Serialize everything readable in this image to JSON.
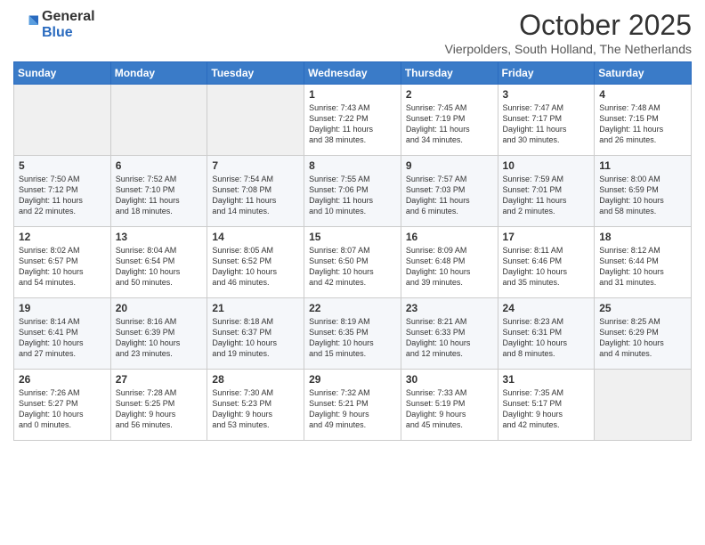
{
  "logo": {
    "general": "General",
    "blue": "Blue"
  },
  "header": {
    "month": "October 2025",
    "location": "Vierpolders, South Holland, The Netherlands"
  },
  "weekdays": [
    "Sunday",
    "Monday",
    "Tuesday",
    "Wednesday",
    "Thursday",
    "Friday",
    "Saturday"
  ],
  "weeks": [
    [
      {
        "day": "",
        "content": ""
      },
      {
        "day": "",
        "content": ""
      },
      {
        "day": "",
        "content": ""
      },
      {
        "day": "1",
        "content": "Sunrise: 7:43 AM\nSunset: 7:22 PM\nDaylight: 11 hours\nand 38 minutes."
      },
      {
        "day": "2",
        "content": "Sunrise: 7:45 AM\nSunset: 7:19 PM\nDaylight: 11 hours\nand 34 minutes."
      },
      {
        "day": "3",
        "content": "Sunrise: 7:47 AM\nSunset: 7:17 PM\nDaylight: 11 hours\nand 30 minutes."
      },
      {
        "day": "4",
        "content": "Sunrise: 7:48 AM\nSunset: 7:15 PM\nDaylight: 11 hours\nand 26 minutes."
      }
    ],
    [
      {
        "day": "5",
        "content": "Sunrise: 7:50 AM\nSunset: 7:12 PM\nDaylight: 11 hours\nand 22 minutes."
      },
      {
        "day": "6",
        "content": "Sunrise: 7:52 AM\nSunset: 7:10 PM\nDaylight: 11 hours\nand 18 minutes."
      },
      {
        "day": "7",
        "content": "Sunrise: 7:54 AM\nSunset: 7:08 PM\nDaylight: 11 hours\nand 14 minutes."
      },
      {
        "day": "8",
        "content": "Sunrise: 7:55 AM\nSunset: 7:06 PM\nDaylight: 11 hours\nand 10 minutes."
      },
      {
        "day": "9",
        "content": "Sunrise: 7:57 AM\nSunset: 7:03 PM\nDaylight: 11 hours\nand 6 minutes."
      },
      {
        "day": "10",
        "content": "Sunrise: 7:59 AM\nSunset: 7:01 PM\nDaylight: 11 hours\nand 2 minutes."
      },
      {
        "day": "11",
        "content": "Sunrise: 8:00 AM\nSunset: 6:59 PM\nDaylight: 10 hours\nand 58 minutes."
      }
    ],
    [
      {
        "day": "12",
        "content": "Sunrise: 8:02 AM\nSunset: 6:57 PM\nDaylight: 10 hours\nand 54 minutes."
      },
      {
        "day": "13",
        "content": "Sunrise: 8:04 AM\nSunset: 6:54 PM\nDaylight: 10 hours\nand 50 minutes."
      },
      {
        "day": "14",
        "content": "Sunrise: 8:05 AM\nSunset: 6:52 PM\nDaylight: 10 hours\nand 46 minutes."
      },
      {
        "day": "15",
        "content": "Sunrise: 8:07 AM\nSunset: 6:50 PM\nDaylight: 10 hours\nand 42 minutes."
      },
      {
        "day": "16",
        "content": "Sunrise: 8:09 AM\nSunset: 6:48 PM\nDaylight: 10 hours\nand 39 minutes."
      },
      {
        "day": "17",
        "content": "Sunrise: 8:11 AM\nSunset: 6:46 PM\nDaylight: 10 hours\nand 35 minutes."
      },
      {
        "day": "18",
        "content": "Sunrise: 8:12 AM\nSunset: 6:44 PM\nDaylight: 10 hours\nand 31 minutes."
      }
    ],
    [
      {
        "day": "19",
        "content": "Sunrise: 8:14 AM\nSunset: 6:41 PM\nDaylight: 10 hours\nand 27 minutes."
      },
      {
        "day": "20",
        "content": "Sunrise: 8:16 AM\nSunset: 6:39 PM\nDaylight: 10 hours\nand 23 minutes."
      },
      {
        "day": "21",
        "content": "Sunrise: 8:18 AM\nSunset: 6:37 PM\nDaylight: 10 hours\nand 19 minutes."
      },
      {
        "day": "22",
        "content": "Sunrise: 8:19 AM\nSunset: 6:35 PM\nDaylight: 10 hours\nand 15 minutes."
      },
      {
        "day": "23",
        "content": "Sunrise: 8:21 AM\nSunset: 6:33 PM\nDaylight: 10 hours\nand 12 minutes."
      },
      {
        "day": "24",
        "content": "Sunrise: 8:23 AM\nSunset: 6:31 PM\nDaylight: 10 hours\nand 8 minutes."
      },
      {
        "day": "25",
        "content": "Sunrise: 8:25 AM\nSunset: 6:29 PM\nDaylight: 10 hours\nand 4 minutes."
      }
    ],
    [
      {
        "day": "26",
        "content": "Sunrise: 7:26 AM\nSunset: 5:27 PM\nDaylight: 10 hours\nand 0 minutes."
      },
      {
        "day": "27",
        "content": "Sunrise: 7:28 AM\nSunset: 5:25 PM\nDaylight: 9 hours\nand 56 minutes."
      },
      {
        "day": "28",
        "content": "Sunrise: 7:30 AM\nSunset: 5:23 PM\nDaylight: 9 hours\nand 53 minutes."
      },
      {
        "day": "29",
        "content": "Sunrise: 7:32 AM\nSunset: 5:21 PM\nDaylight: 9 hours\nand 49 minutes."
      },
      {
        "day": "30",
        "content": "Sunrise: 7:33 AM\nSunset: 5:19 PM\nDaylight: 9 hours\nand 45 minutes."
      },
      {
        "day": "31",
        "content": "Sunrise: 7:35 AM\nSunset: 5:17 PM\nDaylight: 9 hours\nand 42 minutes."
      },
      {
        "day": "",
        "content": ""
      }
    ]
  ]
}
